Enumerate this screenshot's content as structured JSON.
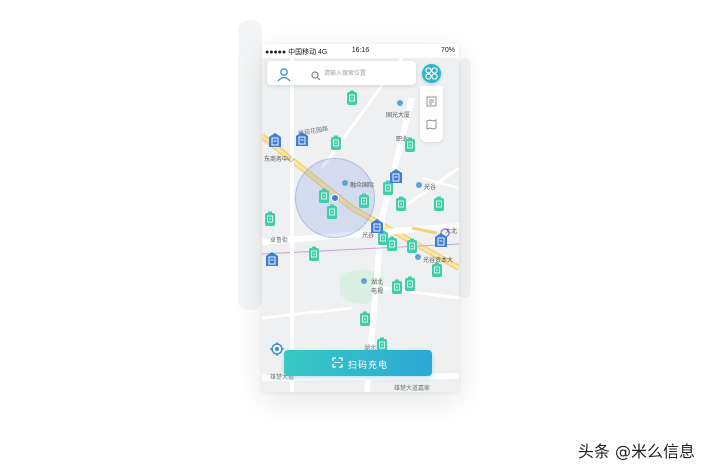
{
  "status_bar": {
    "carrier": "●●●●● 中国移动 4G",
    "time": "16:16",
    "battery": "70%"
  },
  "search": {
    "placeholder": "请输入搜索位置",
    "avatar_icon": "user-avatar-icon",
    "search_icon": "search-icon"
  },
  "top_right_button": {
    "icon": "grid-menu-icon"
  },
  "side_panel": {
    "items": [
      {
        "icon": "list-icon"
      },
      {
        "icon": "map-toggle-icon"
      }
    ]
  },
  "map_labels": {
    "guoguang": "国光大厦",
    "zhiye": "职业",
    "purple_road": "紫菘花园路",
    "dongshangwu": "东商务中心",
    "jiezhong": "融众国际",
    "guanggu": "光谷",
    "luoyu_street": "卓鲁街",
    "guanggu_short": "光谷",
    "dabeilin": "大北",
    "guanggu_zihe": "光谷资本大",
    "hubei_tv": "湖北",
    "hubei_tv2": "电视",
    "hubei_kaifa": "湖北开发",
    "xiongchu_left": "雄楚大道",
    "xiongchu_right": "雄楚大道嘉家"
  },
  "locate_button": {
    "icon": "locate-icon"
  },
  "scan_button": {
    "label": "扫码充电",
    "icon": "scan-icon"
  },
  "watermark": "头条 @米么信息",
  "colors": {
    "accent": "#2bb8c8",
    "marker": "#3ecfa8",
    "station": "#3e7fd6"
  }
}
